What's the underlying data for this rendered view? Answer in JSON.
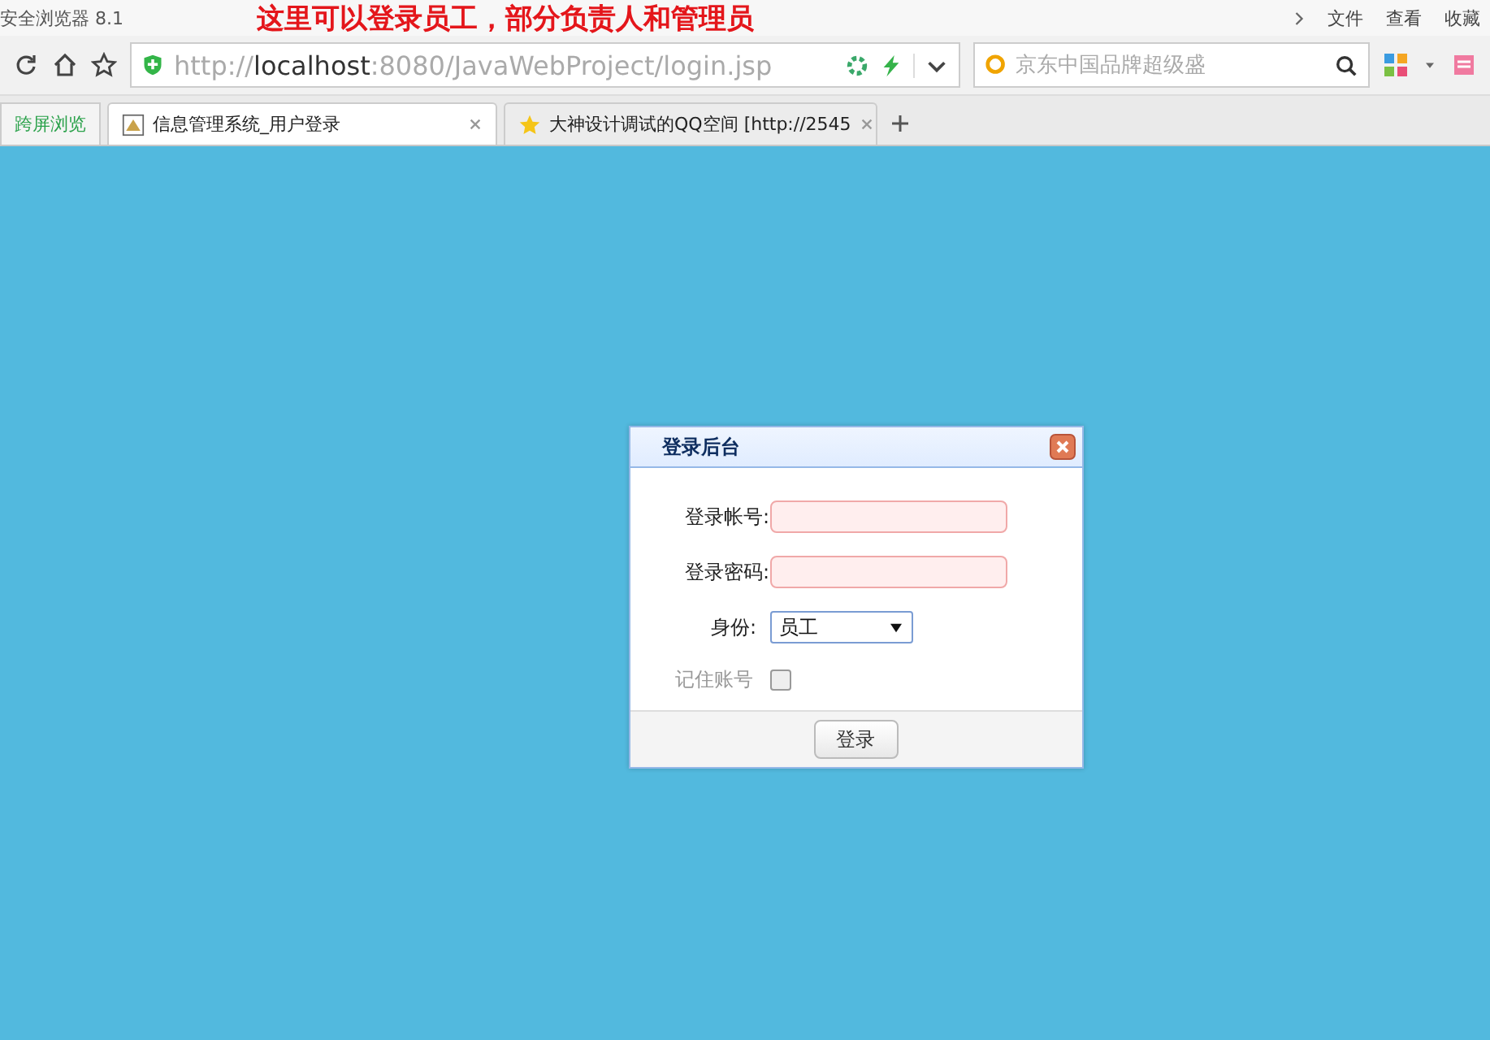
{
  "browser": {
    "title": "安全浏览器 8.1",
    "annotation": "这里可以登录员工，部分负责人和管理员",
    "menu": [
      "文件",
      "查看",
      "收藏"
    ]
  },
  "address_bar": {
    "scheme": "http://",
    "host": "localhost",
    "path": ":8080/JavaWebProject/login.jsp"
  },
  "search": {
    "placeholder": "京东中国品牌超级盛"
  },
  "sidebar_button": "跨屏浏览",
  "tabs": [
    {
      "title": "信息管理系统_用户登录",
      "selected": true
    },
    {
      "title": "大神设计调试的QQ空间 [http://2545",
      "selected": false
    }
  ],
  "dialog": {
    "title": "登录后台",
    "fields": [
      {
        "label": "登录帐号:"
      },
      {
        "label": "登录密码:"
      }
    ],
    "role": {
      "label": "身份:",
      "value": "员工"
    },
    "remember": {
      "label": "记住账号",
      "checked": false
    },
    "submit": "登录"
  }
}
